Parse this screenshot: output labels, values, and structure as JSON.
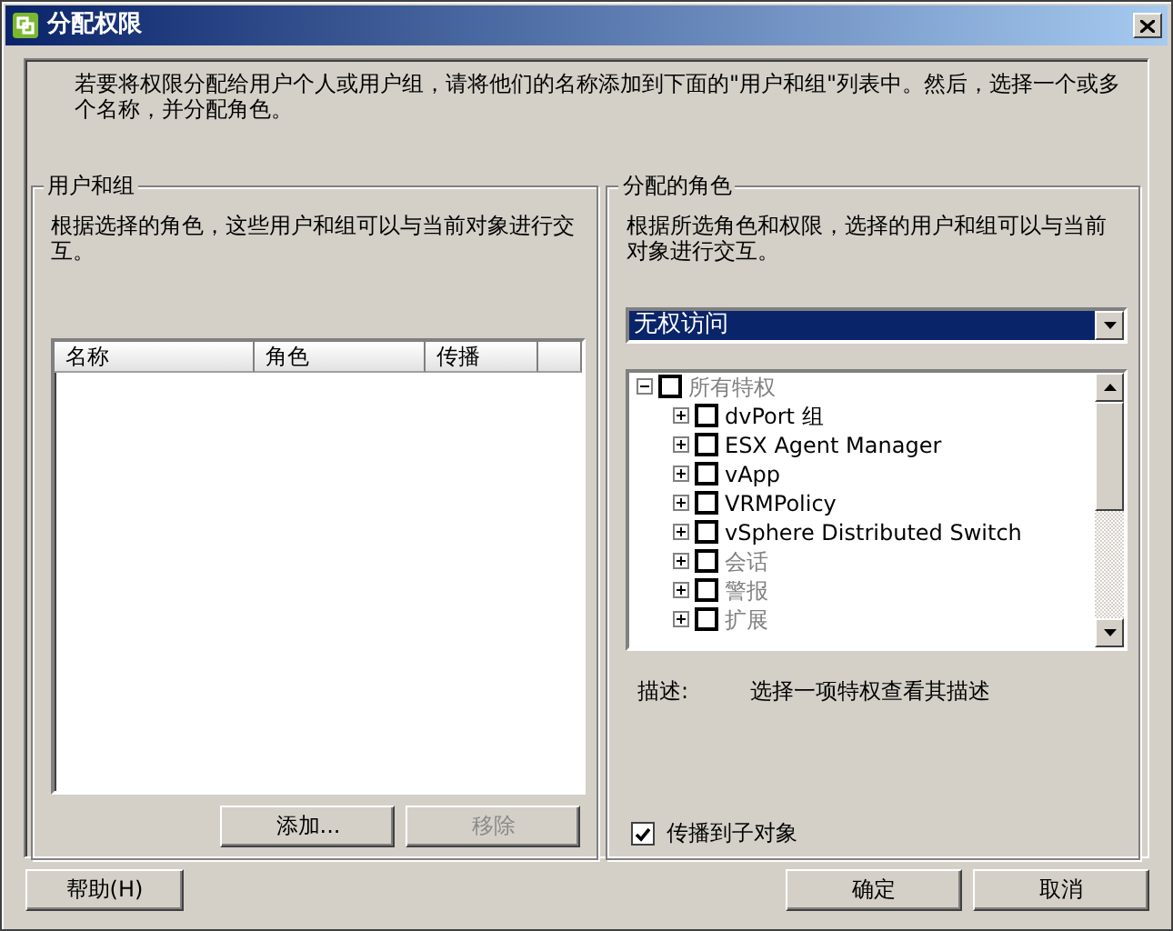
{
  "window": {
    "title": "分配权限"
  },
  "intro": "若要将权限分配给用户个人或用户组，请将他们的名称添加到下面的\"用户和组\"列表中。然后，选择一个或多个名称，并分配角色。",
  "users_group": {
    "title": "用户和组",
    "description": "根据选择的角色，这些用户和组可以与当前对象进行交互。",
    "table": {
      "columns": [
        "名称",
        "角色",
        "传播"
      ]
    },
    "buttons": [
      {
        "label": "添加...",
        "disabled": false
      },
      {
        "label": "移除",
        "disabled": true
      }
    ]
  },
  "roles_group": {
    "title": "分配的角色",
    "description": "根据所选角色和权限，选择的用户和组可以与当前对象进行交互。",
    "role_select": {
      "value": "无权访问"
    },
    "tree": [
      {
        "label": "所有特权",
        "checked": false,
        "disabled": true,
        "expanded": true,
        "children": [
          {
            "label": "dvPort 组",
            "checked": false,
            "disabled": false,
            "expanded": false
          },
          {
            "label": "ESX Agent Manager",
            "checked": false,
            "disabled": false,
            "expanded": false
          },
          {
            "label": "vApp",
            "checked": false,
            "disabled": false,
            "expanded": false
          },
          {
            "label": "VRMPolicy",
            "checked": false,
            "disabled": false,
            "expanded": false
          },
          {
            "label": "vSphere Distributed Switch",
            "checked": false,
            "disabled": false,
            "expanded": false
          },
          {
            "label": "会话",
            "checked": false,
            "disabled": true,
            "expanded": false
          },
          {
            "label": "警报",
            "checked": false,
            "disabled": true,
            "expanded": false
          },
          {
            "label": "扩展",
            "checked": false,
            "disabled": true,
            "expanded": false
          }
        ]
      }
    ],
    "description_label": "描述:",
    "description_text": "选择一项特权查看其描述",
    "propagate": {
      "label": "传播到子对象",
      "checked": true
    }
  },
  "buttons": {
    "help": "帮助(H)",
    "ok": "确定",
    "cancel": "取消"
  }
}
